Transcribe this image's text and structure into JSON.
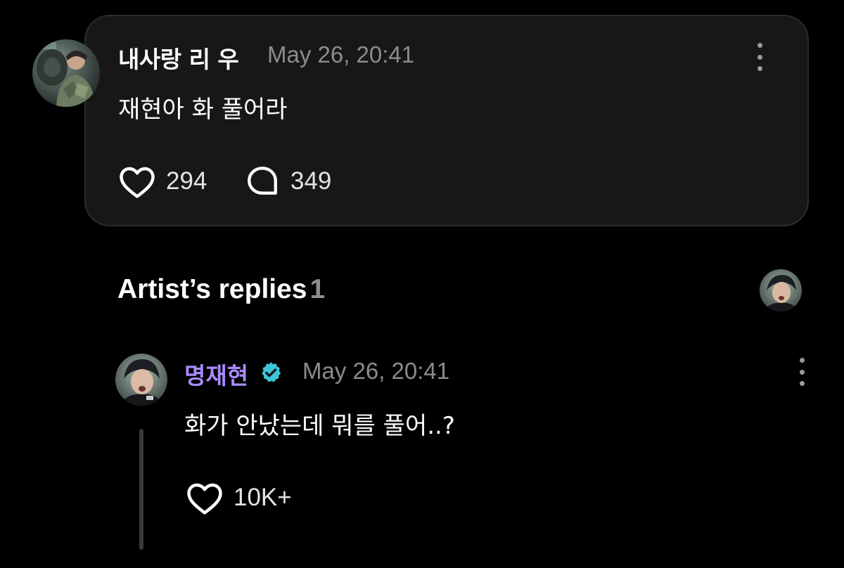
{
  "post": {
    "author": "내사랑 리 우",
    "timestamp": "May 26, 20:41",
    "body": "재현아 화 풀어라",
    "likes": "294",
    "comments": "349",
    "avatar": "user-avatar"
  },
  "replies_section": {
    "title": "Artist’s replies",
    "count": "1",
    "avatar": "artist-avatar"
  },
  "reply": {
    "author": "명재현",
    "verified": true,
    "timestamp": "May 26, 20:41",
    "body": "화가 안났는데 뭐를 풀어..?",
    "likes": "10K+",
    "avatar": "artist-avatar"
  },
  "colors": {
    "background": "#000000",
    "card": "#171717",
    "card_border": "#2c2c2c",
    "artist_name": "#a98bff",
    "verified_badge": "#3ec6d8",
    "muted_text": "#8c8c8c"
  },
  "icons": {
    "like": "heart-outline-icon",
    "comment": "speech-bubble-icon",
    "more": "vertical-ellipsis-icon",
    "verified": "verified-badge-icon"
  }
}
